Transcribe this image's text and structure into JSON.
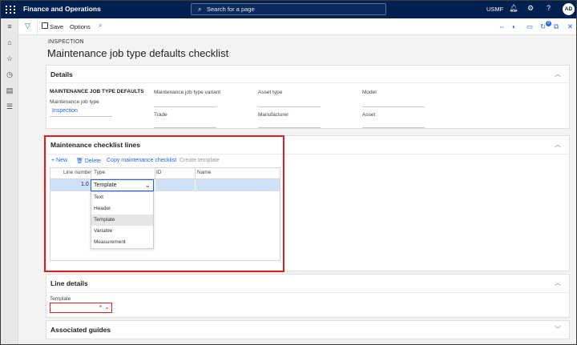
{
  "topbar": {
    "app_title": "Finance and Operations",
    "search_placeholder": "Search for a page",
    "company": "USMF",
    "avatar_initials": "AD"
  },
  "actionbar": {
    "save_label": "Save",
    "options_label": "Options",
    "notification_count": "0"
  },
  "page": {
    "caption": "INSPECTION",
    "title": "Maintenance job type defaults checklist"
  },
  "details": {
    "header": "Details",
    "group_title": "MAINTENANCE JOB TYPE DEFAULTS",
    "fields": {
      "job_type_label": "Maintenance job type",
      "job_type_value": "Inspection",
      "job_type_variant_label": "Maintenance job type variant",
      "trade_label": "Trade",
      "asset_type_label": "Asset type",
      "manufacturer_label": "Manufacturer",
      "model_label": "Model",
      "asset_label": "Asset"
    }
  },
  "checklist": {
    "header": "Maintenance checklist lines",
    "toolbar": {
      "new": "New",
      "delete": "Delete",
      "copy": "Copy maintenance checklist",
      "create_template": "Create template"
    },
    "columns": [
      "Line number",
      "Type",
      "ID",
      "Name"
    ],
    "row": {
      "line_number": "1.0",
      "type": "Template"
    },
    "type_options": [
      "Text",
      "Header",
      "Template",
      "Variable",
      "Measurement"
    ],
    "selected_option": "Template"
  },
  "line_details": {
    "header": "Line details",
    "template_label": "Template",
    "required_marker": "*"
  },
  "associated_guides": {
    "header": "Associated guides"
  },
  "colors": {
    "nav": "#002050",
    "accent": "#2266e3",
    "highlight": "#e21b1b",
    "row_selected": "#cfe0f7"
  }
}
